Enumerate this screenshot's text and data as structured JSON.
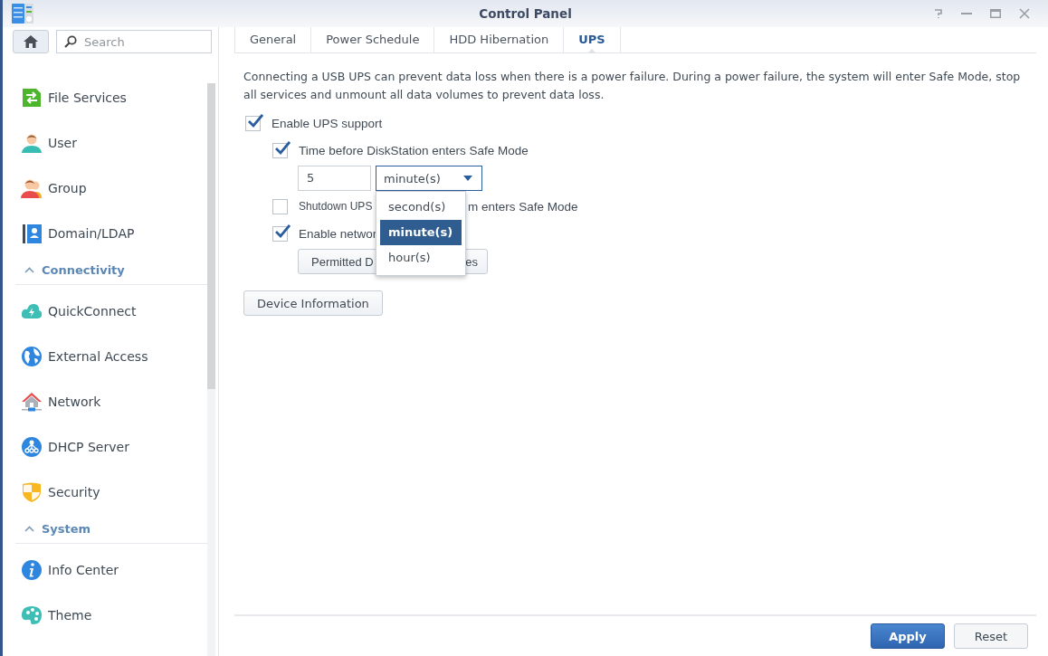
{
  "window": {
    "title": "Control Panel"
  },
  "search": {
    "placeholder": "Search"
  },
  "sidebar": {
    "items": [
      {
        "kind": "item",
        "label": "File Services"
      },
      {
        "kind": "item",
        "label": "User"
      },
      {
        "kind": "item",
        "label": "Group"
      },
      {
        "kind": "item",
        "label": "Domain/LDAP"
      },
      {
        "kind": "section",
        "label": "Connectivity",
        "expanded": true
      },
      {
        "kind": "item",
        "label": "QuickConnect"
      },
      {
        "kind": "item",
        "label": "External Access"
      },
      {
        "kind": "item",
        "label": "Network"
      },
      {
        "kind": "item",
        "label": "DHCP Server"
      },
      {
        "kind": "item",
        "label": "Security"
      },
      {
        "kind": "section",
        "label": "System",
        "expanded": true
      },
      {
        "kind": "item",
        "label": "Info Center"
      },
      {
        "kind": "item",
        "label": "Theme"
      }
    ]
  },
  "tabs": [
    {
      "label": "General",
      "selected": false
    },
    {
      "label": "Power Schedule",
      "selected": false
    },
    {
      "label": "HDD Hibernation",
      "selected": false
    },
    {
      "label": "UPS",
      "selected": true
    }
  ],
  "description": "Connecting a USB UPS can prevent data loss when there is a power failure. During a power failure, the system will enter Safe Mode, stop all services and unmount all data volumes to prevent data loss.",
  "options": [
    {
      "kind": "checkbox",
      "label": "Enable UPS support",
      "checked": true,
      "children": [
        {
          "kind": "checkbox",
          "label": "Time before DiskStation enters Safe Mode",
          "checked": true,
          "children": [
            {
              "kind": "time",
              "value": "5",
              "unit": "minute(s)",
              "menu": [
                {
                  "label": "second(s)",
                  "selected": false
                },
                {
                  "label": "minute(s)",
                  "selected": true
                },
                {
                  "label": "hour(s)",
                  "selected": false
                }
              ]
            }
          ]
        },
        {
          "kind": "checkbox",
          "label_parts": [
            "Shutdown UPS",
            "m enters Safe Mode"
          ],
          "checked": false
        },
        {
          "kind": "checkbox",
          "label": "Enable networ",
          "checked": true,
          "children": [
            {
              "kind": "button",
              "label_parts": [
                "Permitted D",
                "es"
              ]
            }
          ]
        }
      ]
    }
  ],
  "device_info_button": "Device Information",
  "footer_buttons": [
    {
      "label": "Apply",
      "kind": "primary"
    },
    {
      "label": "Reset",
      "kind": "secondary"
    }
  ]
}
